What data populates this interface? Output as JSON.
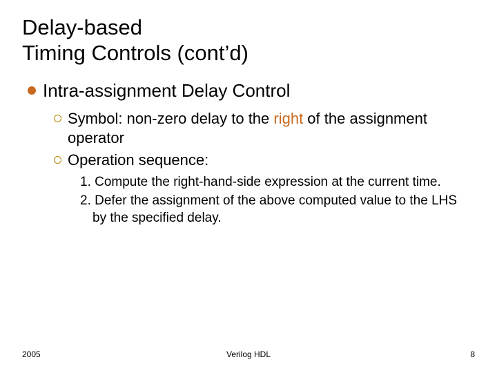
{
  "title_line1": "Delay-based",
  "title_line2": "Timing Controls (cont’d)",
  "colors": {
    "l1_bullet": "#c7691e",
    "accent": "#c7691e",
    "l2_ring": "#b38600"
  },
  "l1": {
    "text": "Intra-assignment Delay Control"
  },
  "l2": [
    {
      "prefix": "Symbol: non-zero delay to the ",
      "accent": "right",
      "suffix": " of the assignment operator"
    },
    {
      "prefix": "Operation sequence:",
      "accent": "",
      "suffix": ""
    }
  ],
  "l3": [
    "1. Compute the right-hand-side expression at the current time.",
    "2. Defer the assignment of the above computed value to the LHS by the specified delay."
  ],
  "footer": {
    "left": "2005",
    "center": "Verilog HDL",
    "right": "8"
  }
}
